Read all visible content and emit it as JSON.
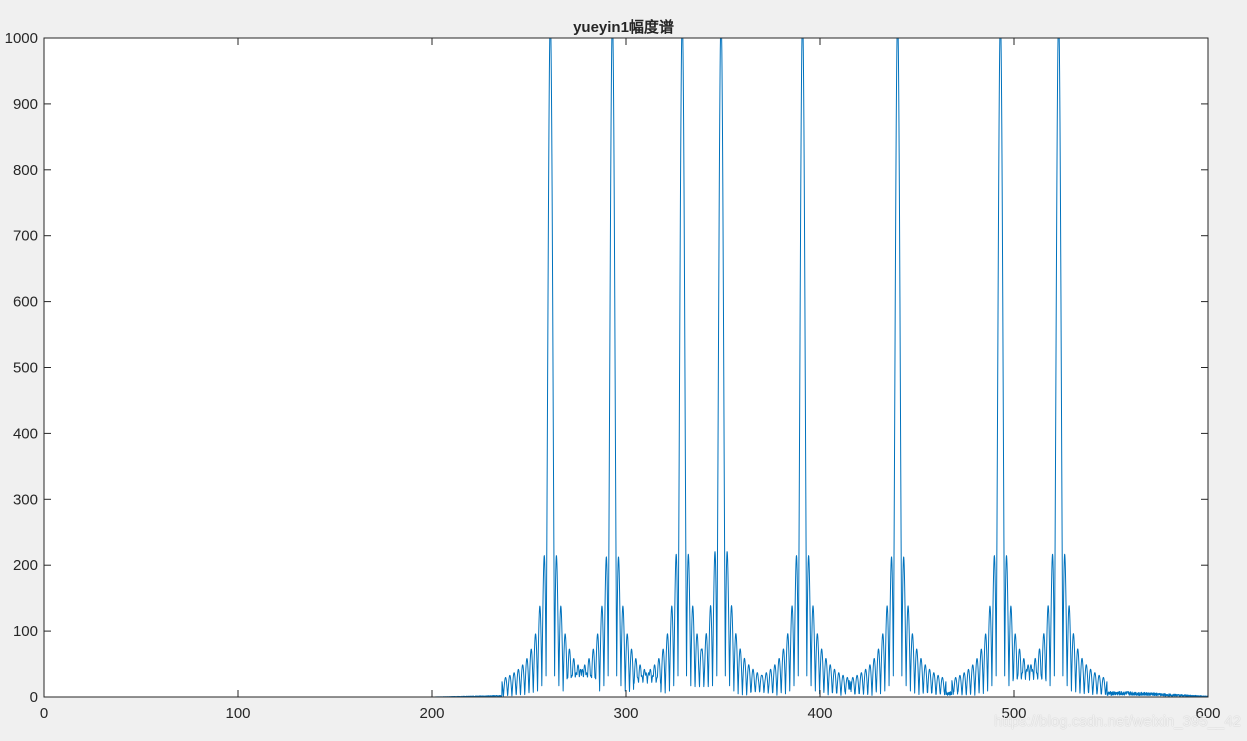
{
  "colors": {
    "line": "#0072BD",
    "axis": "#262626",
    "grid": "#dcdcdc",
    "background": "#f0f0f0",
    "plot_area": "#ffffff"
  },
  "watermark": "https://blog.csdn.net/weixin_395__42",
  "chart_data": {
    "type": "line",
    "title": "yueyin1幅度谱",
    "xlabel": "",
    "ylabel": "",
    "xlim": [
      0,
      600
    ],
    "ylim": [
      0,
      1000
    ],
    "grid": false,
    "box": true,
    "x_ticks": [
      0,
      100,
      200,
      300,
      400,
      500,
      600
    ],
    "y_ticks": [
      0,
      100,
      200,
      300,
      400,
      500,
      600,
      700,
      800,
      900,
      1000
    ],
    "peaks": [
      {
        "x": 261,
        "y": 975,
        "side_lobe": 190
      },
      {
        "x": 293,
        "y": 975,
        "side_lobe": 188
      },
      {
        "x": 329,
        "y": 976,
        "side_lobe": 192
      },
      {
        "x": 349,
        "y": 980,
        "side_lobe": 196
      },
      {
        "x": 391,
        "y": 978,
        "side_lobe": 190
      },
      {
        "x": 440,
        "y": 977,
        "side_lobe": 188
      },
      {
        "x": 493,
        "y": 975,
        "side_lobe": 190
      },
      {
        "x": 523,
        "y": 979,
        "side_lobe": 192
      }
    ],
    "noise_floor": [
      {
        "x": 0,
        "y": 0
      },
      {
        "x": 200,
        "y": 0
      },
      {
        "x": 240,
        "y": 2
      },
      {
        "x": 250,
        "y": 6
      },
      {
        "x": 560,
        "y": 6
      },
      {
        "x": 600,
        "y": 1
      }
    ]
  }
}
